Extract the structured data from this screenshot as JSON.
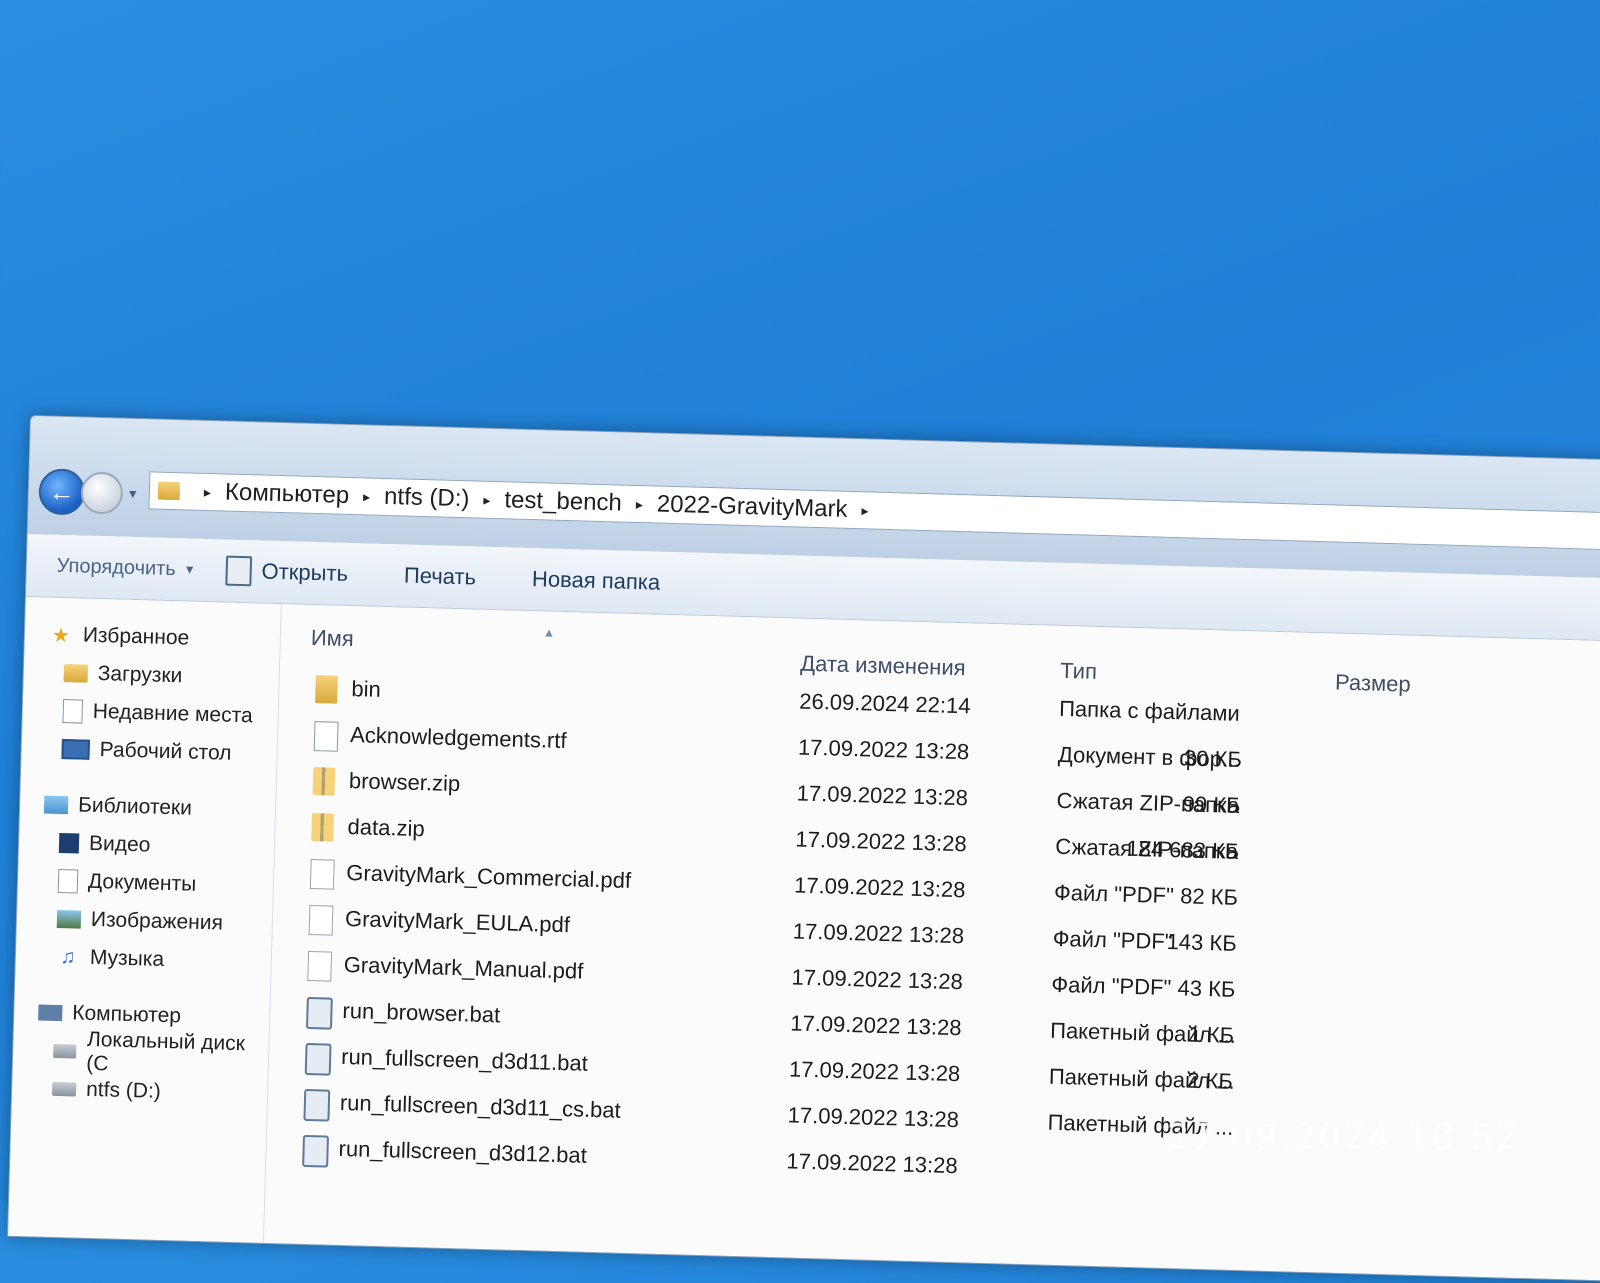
{
  "addressbar": {
    "crumbs": [
      "Компьютер",
      "ntfs (D:)",
      "test_bench",
      "2022-GravityMark"
    ]
  },
  "toolbar": {
    "organize": "Упорядочить",
    "open": "Открыть",
    "print": "Печать",
    "new_folder": "Новая папка"
  },
  "sidebar": {
    "favorites": "Избранное",
    "downloads": "Загрузки",
    "recent": "Недавние места",
    "desktop": "Рабочий стол",
    "libraries": "Библиотеки",
    "video": "Видео",
    "documents": "Документы",
    "images": "Изображения",
    "music": "Музыка",
    "computer": "Компьютер",
    "local_disk": "Локальный диск (C",
    "ntfs": "ntfs (D:)"
  },
  "columns": {
    "name": "Имя",
    "date": "Дата изменения",
    "type": "Тип",
    "size": "Размер"
  },
  "files": [
    {
      "name": "bin",
      "date": "26.09.2024 22:14",
      "type": "Папка с файлами",
      "size": "",
      "icon": "folder"
    },
    {
      "name": "Acknowledgements.rtf",
      "date": "17.09.2022 13:28",
      "type": "Документ в фор...",
      "size": "30 КБ",
      "icon": "rtf"
    },
    {
      "name": "browser.zip",
      "date": "17.09.2022 13:28",
      "type": "Сжатая ZIP-папка",
      "size": "99 КБ",
      "icon": "zip"
    },
    {
      "name": "data.zip",
      "date": "17.09.2022 13:28",
      "type": "Сжатая ZIP-папка",
      "size": "184 683 КБ",
      "icon": "zip"
    },
    {
      "name": "GravityMark_Commercial.pdf",
      "date": "17.09.2022 13:28",
      "type": "Файл \"PDF\"",
      "size": "82 КБ",
      "icon": "pdf"
    },
    {
      "name": "GravityMark_EULA.pdf",
      "date": "17.09.2022 13:28",
      "type": "Файл \"PDF\"",
      "size": "143 КБ",
      "icon": "pdf"
    },
    {
      "name": "GravityMark_Manual.pdf",
      "date": "17.09.2022 13:28",
      "type": "Файл \"PDF\"",
      "size": "43 КБ",
      "icon": "pdf"
    },
    {
      "name": "run_browser.bat",
      "date": "17.09.2022 13:28",
      "type": "Пакетный файл ...",
      "size": "1 КБ",
      "icon": "bat"
    },
    {
      "name": "run_fullscreen_d3d11.bat",
      "date": "17.09.2022 13:28",
      "type": "Пакетный файл ...",
      "size": "2 КБ",
      "icon": "bat"
    },
    {
      "name": "run_fullscreen_d3d11_cs.bat",
      "date": "17.09.2022 13:28",
      "type": "Пакетный файл ...",
      "size": "",
      "icon": "bat"
    },
    {
      "name": "run_fullscreen_d3d12.bat",
      "date": "17.09.2022 13:28",
      "type": "",
      "size": "",
      "icon": "bat"
    }
  ],
  "overlay": {
    "timestamp": "27.09.2024 18:52"
  }
}
